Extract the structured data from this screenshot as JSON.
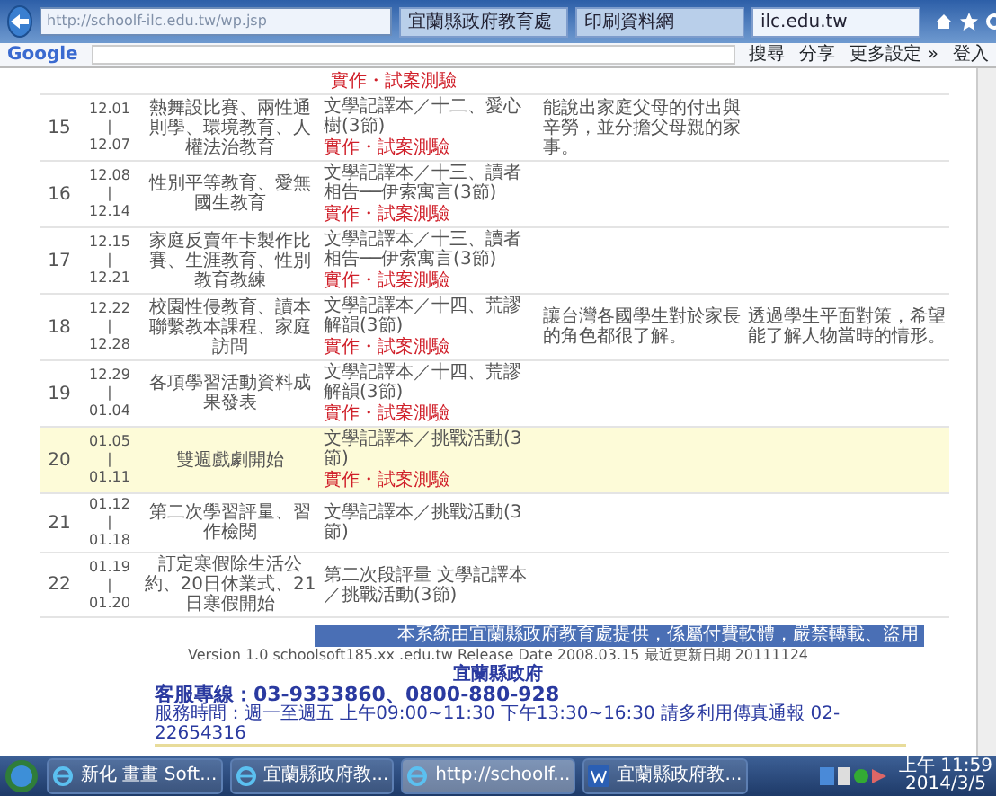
{
  "browser": {
    "address": "http://schoolf-ilc.edu.tw/wp.jsp",
    "tabs": [
      {
        "label": "宜蘭縣政府教育處",
        "selected": false
      },
      {
        "label": "印刷資料網",
        "selected": false
      },
      {
        "label": "ilc.edu.tw",
        "selected": true
      }
    ],
    "toolbar": {
      "logo": "Google",
      "items": [
        "搜尋",
        "分享",
        "更多設定 »"
      ],
      "login": "登入"
    }
  },
  "table": {
    "partial_row": {
      "note": "實作・試案測驗"
    },
    "rows": [
      {
        "week": "15",
        "dates": [
          "12.01",
          "|",
          "12.07"
        ],
        "topic": "熱舞設比賽、兩性通則學、環境教育、人權法治教育",
        "reading": "文學記譯本／十二、愛心樹(3節)",
        "note": "實作・試案測驗",
        "column_5": "能說出家庭父母的付出與辛勞，並分擔父母親的家事。",
        "highlighted": false
      },
      {
        "week": "16",
        "dates": [
          "12.08",
          "|",
          "12.14"
        ],
        "topic": "性別平等教育、愛無國生教育",
        "reading": "文學記譯本／十三、讀者相告──伊索寓言(3節)",
        "note": "實作・試案測驗",
        "highlighted": false
      },
      {
        "week": "17",
        "dates": [
          "12.15",
          "|",
          "12.21"
        ],
        "topic": "家庭反賣年卡製作比賽、生涯教育、性別教育教練",
        "reading": "文學記譯本／十三、讀者相告──伊索寓言(3節)",
        "note": "實作・試案測驗",
        "highlighted": false
      },
      {
        "week": "18",
        "dates": [
          "12.22",
          "|",
          "12.28"
        ],
        "topic": "校園性侵教育、讀本聯繫教本課程、家庭訪問",
        "reading": "文學記譯本／十四、荒謬解韻(3節)",
        "note": "實作・試案測驗",
        "column_5": "讓台灣各國學生對於家長的角色都很了解。",
        "column_6": "透過學生平面對策，希望能了解人物當時的情形。",
        "highlighted": false
      },
      {
        "week": "19",
        "dates": [
          "12.29",
          "|",
          "01.04"
        ],
        "topic": "各項學習活動資料成果發表",
        "reading": "文學記譯本／十四、荒謬解韻(3節)",
        "note": "實作・試案測驗",
        "highlighted": false
      },
      {
        "week": "20",
        "dates": [
          "01.05",
          "|",
          "01.11"
        ],
        "topic": "雙週戲劇開始",
        "reading": "文學記譯本／挑戰活動(3節)",
        "note": "實作・試案測驗",
        "highlighted": true
      },
      {
        "week": "21",
        "dates": [
          "01.12",
          "|",
          "01.18"
        ],
        "topic": "第二次學習評量、習作檢閱",
        "reading": "文學記譯本／挑戰活動(3節)",
        "highlighted": false
      },
      {
        "week": "22",
        "dates": [
          "01.19",
          "|",
          "01.20"
        ],
        "topic": "訂定寒假除生活公約、20日休業式、21日寒假開始",
        "reading": "第二次段評量 文學記譯本／挑戰活動(3節)",
        "highlighted": false
      }
    ]
  },
  "footer": {
    "banner": "本系統由宜蘭縣政府教育處提供，係屬付費軟體，嚴禁轉載、盜用",
    "version": "Version 1.0 schoolsoft185.xx .edu.tw  Release Date 2008.03.15  最近更新日期 20111124",
    "org": "宜蘭縣政府",
    "hotline": "客服專線：03-9333860、0800-880-928",
    "hours": "服務時間：週一至週五 上午09:00~11:30 下午13:30~16:30 請多利用傳真通報 02-22654316"
  },
  "taskbar": {
    "items": [
      {
        "label": "新化 畫畫 Soft...",
        "kind": "ie",
        "selected": false
      },
      {
        "label": "宜蘭縣政府教...",
        "kind": "ie",
        "selected": false
      },
      {
        "label": "http://schoolf...",
        "kind": "ie",
        "selected": true
      },
      {
        "label": "宜蘭縣政府教...",
        "kind": "word",
        "selected": false
      }
    ],
    "time": "上午 11:59",
    "date": "2014/3/5"
  }
}
